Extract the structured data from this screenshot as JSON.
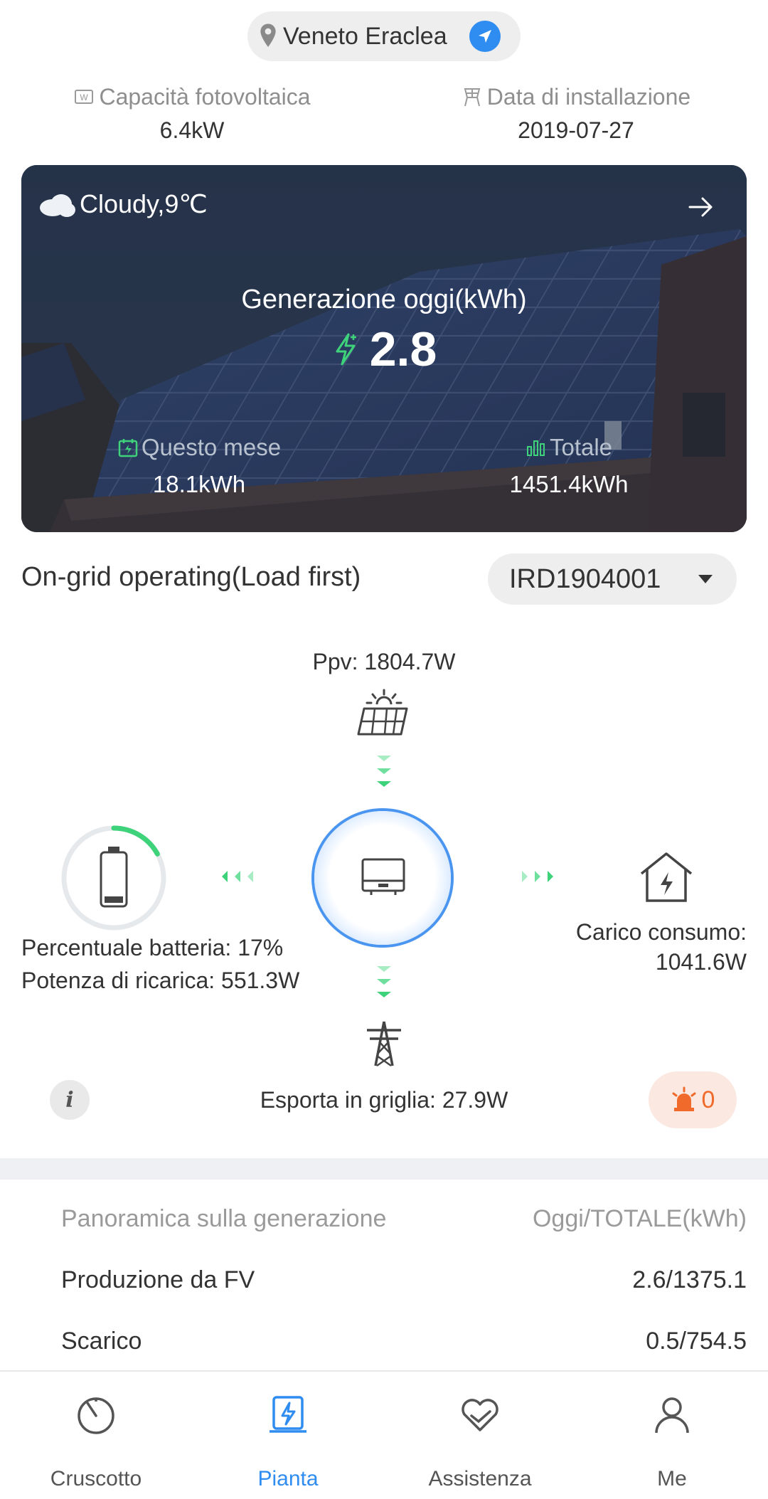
{
  "location": {
    "name": "Veneto Eraclea"
  },
  "plant_info": {
    "capacity_label": "Capacità fotovoltaica",
    "capacity_value": "6.4kW",
    "install_label": "Data di installazione",
    "install_value": "2019-07-27"
  },
  "banner": {
    "weather": "Cloudy,9℃",
    "generation_label": "Generazione oggi(kWh)",
    "generation_value": "2.8",
    "month_label": "Questo mese",
    "month_value": "18.1kWh",
    "total_label": "Totale",
    "total_value": "1451.4kWh"
  },
  "status": {
    "mode": "On-grid operating(Load first)",
    "device": "IRD1904001"
  },
  "flow": {
    "pv": "Ppv: 1804.7W",
    "battery_percent_text": "Percentuale batteria: 17%",
    "battery_percent": 17,
    "charge_power": "Potenza di ricarica: 551.3W",
    "load_label": "Carico consumo:",
    "load_value": "1041.6W",
    "grid": "Esporta in griglia: 27.9W",
    "alarm_count": "0"
  },
  "overview": {
    "header_left": "Panoramica sulla generazione",
    "header_right": "Oggi/TOTALE(kWh)",
    "rows": [
      {
        "label": "Produzione da FV",
        "value": "2.6/1375.1"
      },
      {
        "label": "Scarico",
        "value": "0.5/754.5"
      }
    ]
  },
  "nav": {
    "items": [
      {
        "label": "Cruscotto",
        "icon": "dashboard-icon"
      },
      {
        "label": "Pianta",
        "icon": "plant-icon"
      },
      {
        "label": "Assistenza",
        "icon": "service-icon"
      },
      {
        "label": "Me",
        "icon": "user-icon"
      }
    ],
    "active": 1
  },
  "colors": {
    "accent": "#2f8cf0",
    "flow_green": "#3ed37b",
    "alarm": "#f06a2b"
  }
}
